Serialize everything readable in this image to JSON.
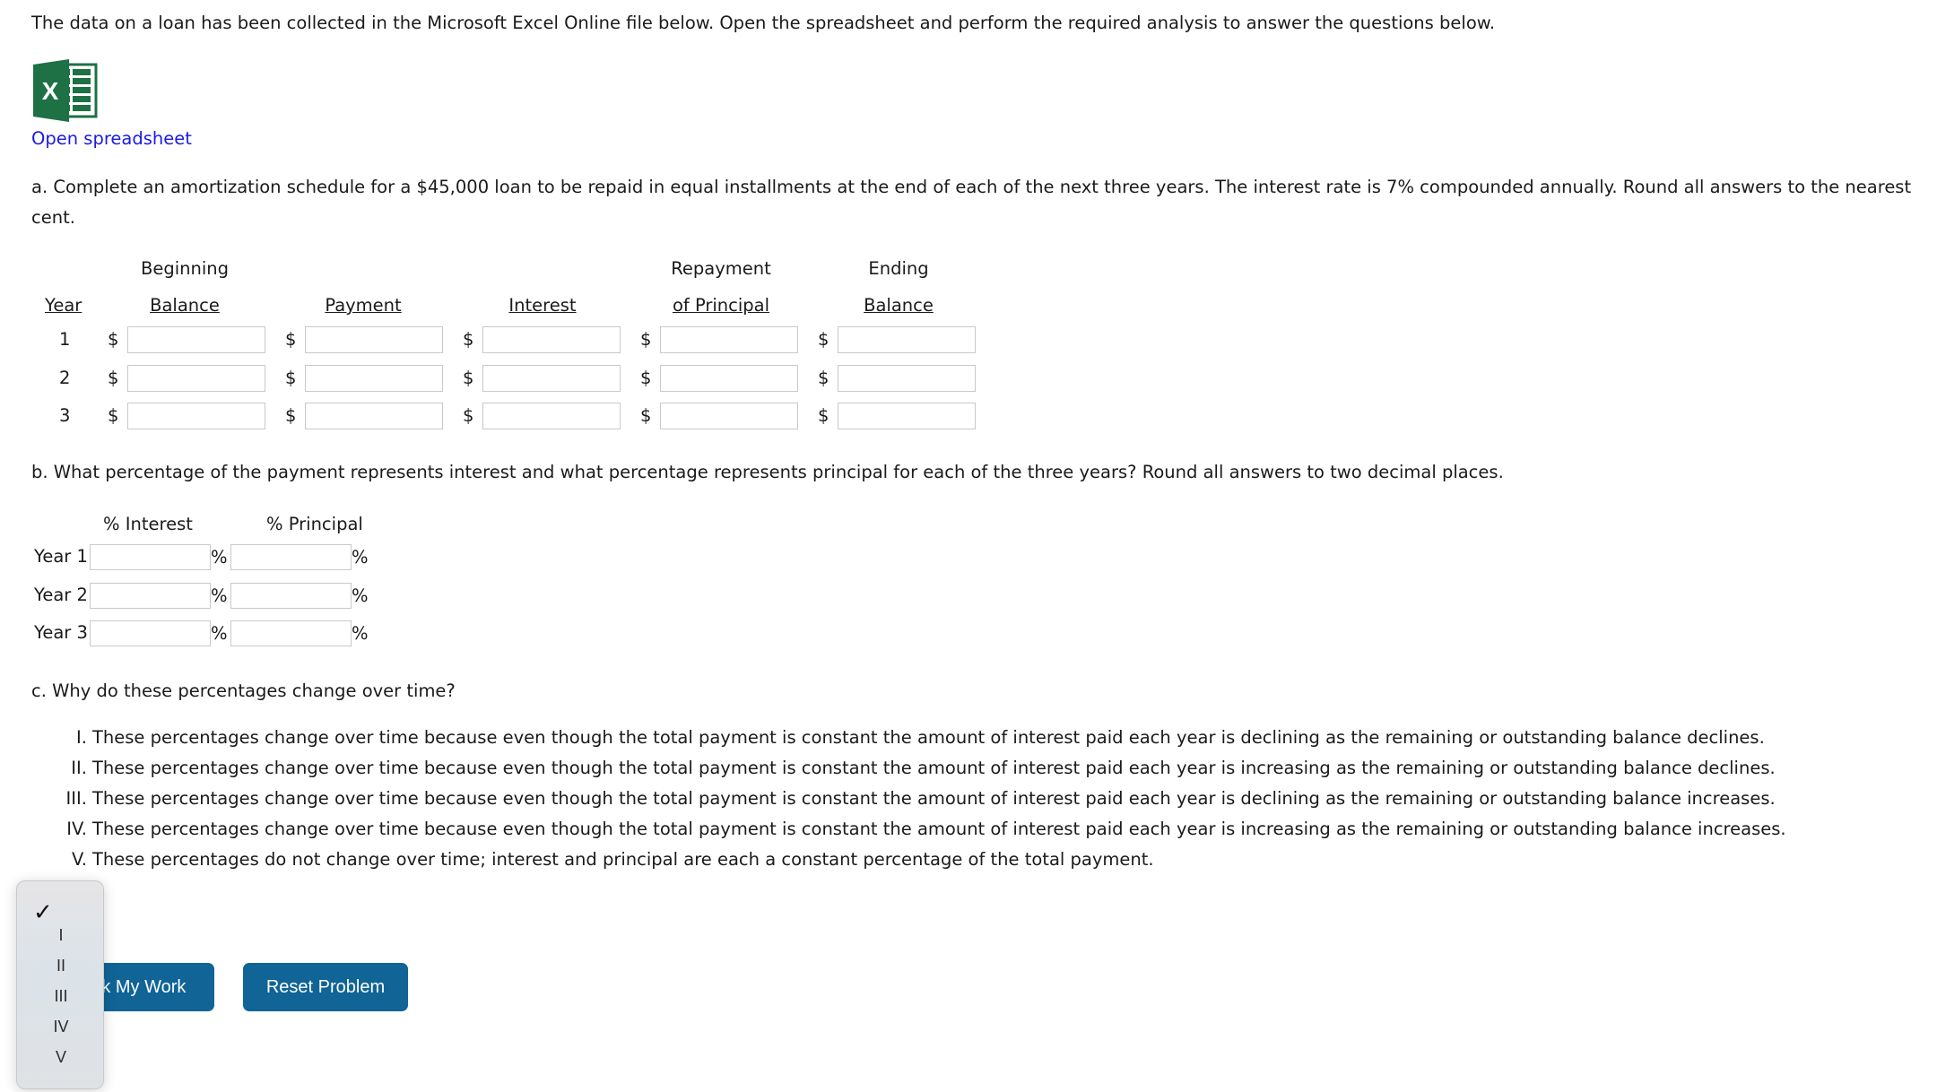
{
  "intro": "The data on a loan has been collected in the Microsoft Excel Online file below. Open the spreadsheet and perform the required analysis to answer the questions below.",
  "spreadsheet": {
    "icon": "excel-icon",
    "link_label": "Open spreadsheet",
    "icon_letter": "X"
  },
  "part_a": {
    "question_line1": "a. Complete an amortization schedule for a $45,000 loan to be repaid in equal installments at the end of each of the next three years. The interest rate is 7% compounded annually. Round all answers to the nearest",
    "question_line2": "cent.",
    "headers": {
      "year": "Year",
      "beginning_top": "Beginning",
      "beginning_bottom": "Balance",
      "payment": "Payment",
      "interest": "Interest",
      "repayment_top": "Repayment",
      "repayment_bottom": "of Principal",
      "ending_top": "Ending",
      "ending_bottom": "Balance"
    },
    "currency_symbol": "$",
    "rows": [
      {
        "year": "1",
        "beginning_balance": "",
        "payment": "",
        "interest": "",
        "repayment_of_principal": "",
        "ending_balance": ""
      },
      {
        "year": "2",
        "beginning_balance": "",
        "payment": "",
        "interest": "",
        "repayment_of_principal": "",
        "ending_balance": ""
      },
      {
        "year": "3",
        "beginning_balance": "",
        "payment": "",
        "interest": "",
        "repayment_of_principal": "",
        "ending_balance": ""
      }
    ]
  },
  "part_b": {
    "question": "b. What percentage of the payment represents interest and what percentage represents principal for each of the three years? Round all answers to two decimal places.",
    "headers": {
      "interest": "% Interest",
      "principal": "% Principal"
    },
    "percent_symbol": "%",
    "rows": [
      {
        "label": "Year 1:",
        "interest": "",
        "principal": ""
      },
      {
        "label": "Year 2:",
        "interest": "",
        "principal": ""
      },
      {
        "label": "Year 3:",
        "interest": "",
        "principal": ""
      }
    ]
  },
  "part_c": {
    "question": "c. Why do these percentages change over time?",
    "options": [
      "I. These percentages change over time because even though the total payment is constant the amount of interest paid each year is declining as the remaining or outstanding balance declines.",
      "II. These percentages change over time because even though the total payment is constant the amount of interest paid each year is increasing as the remaining or outstanding balance declines.",
      "III. These percentages change over time because even though the total payment is constant the amount of interest paid each year is declining as the remaining or outstanding balance increases.",
      "IV. These percentages change over time because even though the total payment is constant the amount of interest paid each year is increasing as the remaining or outstanding balance increases.",
      "V. These percentages do not change over time; interest and principal are each a constant percentage of the total payment."
    ],
    "dropdown": {
      "selected": "",
      "options": [
        "",
        "I",
        "II",
        "III",
        "IV",
        "V"
      ]
    }
  },
  "buttons": {
    "check": "Check My Work",
    "reset": "Reset Problem"
  },
  "colors": {
    "button": "#106496",
    "link": "#1a1ae6",
    "excel_green": "#1e7145"
  }
}
